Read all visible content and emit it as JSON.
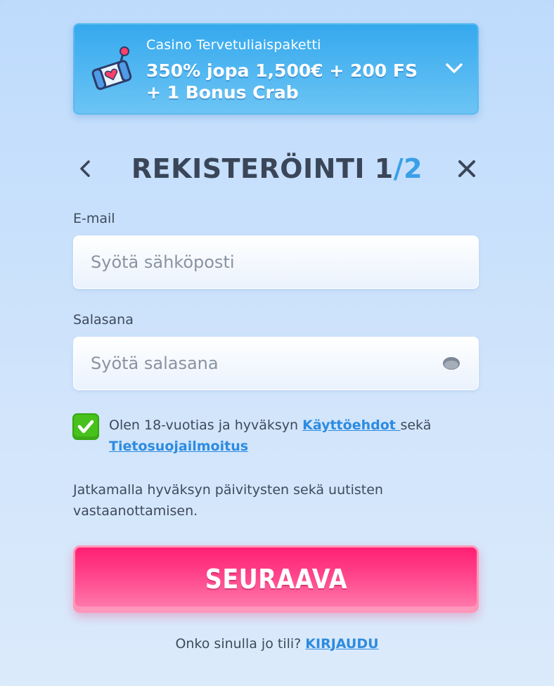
{
  "promo": {
    "subtitle": "Casino Tervetuliaispaketti",
    "title": "350% jopa 1,500€ + 200 FS + 1 Bonus Crab",
    "icon": "claw-machine-heart-icon",
    "chevron_icon": "chevron-down-icon"
  },
  "header": {
    "title": "REKISTERÖINTI",
    "step_current": "1",
    "step_separator": "/",
    "step_total": "2",
    "back_icon": "chevron-left-icon",
    "close_icon": "close-icon"
  },
  "email": {
    "label": "E-mail",
    "placeholder": "Syötä sähköposti",
    "value": ""
  },
  "password": {
    "label": "Salasana",
    "placeholder": "Syötä salasana",
    "value": "",
    "eye_icon": "eye-icon"
  },
  "terms": {
    "checked": true,
    "text_before": "Olen 18-vuotias ja hyväksyn ",
    "link_terms": "Käyttöehdot ",
    "text_between": "sekä",
    "link_privacy": "Tietosuojailmoitus"
  },
  "notice": "Jatkamalla hyväksyn päivitysten sekä uutisten vastaanottamisen.",
  "next_button": "SEURAAVA",
  "login": {
    "question": "Onko sinulla jo tili?",
    "link": "KIRJAUDU"
  },
  "colors": {
    "accent_blue": "#2d8be0",
    "primary_pink": "#ff2b7a",
    "check_green": "#47c21c",
    "text": "#3d4a5c"
  }
}
